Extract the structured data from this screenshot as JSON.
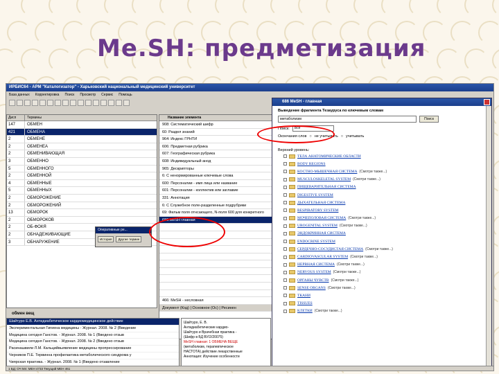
{
  "slide": {
    "title": "Me.SH: предметизация"
  },
  "app": {
    "title": "ИРБИС64 - АРМ \"Каталогизатор\" - Харьковский национальный медицинский университет",
    "menu": [
      "База данных",
      "Корректировка",
      "Поиск",
      "Просмотр",
      "Сервис",
      "Помощь"
    ],
    "left_panel": {
      "headers": [
        "Дисп",
        "Термины"
      ],
      "rows": [
        {
          "n": "147",
          "t": "ОБМЕН"
        },
        {
          "n": "421",
          "t": "ОБМЕНА"
        },
        {
          "n": "2",
          "t": "ОБМЕНЕ"
        },
        {
          "n": "2",
          "t": "ОБМЕНЕА"
        },
        {
          "n": "2",
          "t": "ОБМЕНИВАЮЩАЯ"
        },
        {
          "n": "3",
          "t": "ОБМЕННО"
        },
        {
          "n": "5",
          "t": "ОБМЕННОГО"
        },
        {
          "n": "2",
          "t": "ОБМЕННОЙ"
        },
        {
          "n": "4",
          "t": "ОБМЕННЫЕ"
        },
        {
          "n": "5",
          "t": "ОБМЕННЫХ"
        },
        {
          "n": "2",
          "t": "ОБМОРОЖЕНИЕ"
        },
        {
          "n": "2",
          "t": "ОБМОРОЖЕНИЙ"
        },
        {
          "n": "13",
          "t": "ОБМОРОК"
        },
        {
          "n": "2",
          "t": "ОБМОРОКОВ"
        },
        {
          "n": "2",
          "t": "ОБ-ФОКЯ"
        },
        {
          "n": "2",
          "t": "ОБНАДЕЖИВАЮЩИЕ"
        },
        {
          "n": "3",
          "t": "ОБНАРУЖЕНИЕ"
        }
      ]
    },
    "mid_panel": {
      "header": "Название элемента",
      "rows": [
        "908: Систематический шифр",
        "60: Раздел знаний",
        "964: Индекс ГРНТИ",
        "606: Предметная рубрика",
        "607: Географическая рубрика",
        "608: Индивидуальный анод",
        "965: Дескрипторы",
        "6: С ненормированные ключевые слова",
        "600: Персоналии - имя лица или название",
        "601: Персоналии - коллектив или заглавие",
        "331: Аннотация",
        "6: С Служебное поле-разделенные подрубрики",
        "69: Фильм поля отнсающего, N-поля 600 для конкретного",
        "686:MeSH главная",
        "",
        "",
        "",
        "",
        "",
        "",
        "",
        "",
        "",
        "",
        "466: MeSH - несловная"
      ],
      "selected_index": 13,
      "tabs": "Документ (Код) | Основное (Ос) | Ресинен"
    },
    "popup": {
      "title": "Оперативные ре...",
      "buttons": [
        "История",
        "Другие термин"
      ]
    },
    "bottom": {
      "label": "обмен вещ",
      "rows": [
        "Шайтуро Е.В. Антидиабетическое кардиомедицинское действие",
        "Экспериментальная Гигиена медицины - Журнал. 2008. № 2 (Введение",
        "Медицина сегодня Ганстов. - Журнал. 2008. № 1 (Введено отзыв",
        "Медицина сегодня Ганстов. - Журнал. 2008. № 2 (Введено отзыв",
        "Расинашвили Л.М. Кальцийвыявление медицины пропрессирование",
        "Черников П.Е. Тервинна профилактика метаболического синдрома у",
        "Чиярская практика. - Журнал. 2008. № 1 (Введено отзавление"
      ]
    },
    "detail": {
      "lines": [
        "Шайтуро, Е. В.",
        "Антидиабетические кардио-",
        "Шайтуро и Врачебная практика -",
        "(Шифр в БД ВУ/2/20075)",
        "MeSH главная: 1 ОБМЕНА ВЕЩЕ",
        "(метаболизм, терапевтическое",
        "НАСТОТА) действие лекарственные",
        "Аннотация: Изучение особенности"
      ],
      "highlight": "ОБМЕНА"
    },
    "status": "1 БД: ОЧ Мл: МЕН 4733   Текущий МЕН 461"
  },
  "mesh_window": {
    "title": "686 MeSH - главная",
    "search_caption": "Выведение фрагмента Тезауруса по ключевым словам",
    "search_value": "метаболизм",
    "search_button": "Поиск",
    "field_label": "Поиск:",
    "field_value": "Все",
    "ending_label": "Окончания слов",
    "ending_opt1": "не учитывать",
    "ending_opt2": "учитывать",
    "tree_title": "Верхний уровень:",
    "items": [
      {
        "label": "ТЕЛА АНАТОМИЧЕСКИЕ ОБЛАСТИ",
        "note": ""
      },
      {
        "label": "BODY REGIONS",
        "note": ""
      },
      {
        "label": "КОСТНО-МЫШЕЧНАЯ СИСТЕМА",
        "note": "(Смотри также...)"
      },
      {
        "label": "MUSCULOSKELETAL SYSTEM",
        "note": "(Смотри также...)"
      },
      {
        "label": "ПИЩЕВАРИТЕЛЬНАЯ СИСТЕМА",
        "note": ""
      },
      {
        "label": "DIGESTIVE SYSTEM",
        "note": ""
      },
      {
        "label": "ДЫХАТЕЛЬНАЯ СИСТЕМА",
        "note": ""
      },
      {
        "label": "RESPIRATORY SYSTEM",
        "note": ""
      },
      {
        "label": "МОЧЕПОЛОВАЯ СИСТЕМА",
        "note": "(Смотри также...)"
      },
      {
        "label": "UROGENITAL SYSTEM",
        "note": "(Смотри также...)"
      },
      {
        "label": "ЭНДОКРИННАЯ СИСТЕМА",
        "note": ""
      },
      {
        "label": "ENDOCRINE SYSTEM",
        "note": ""
      },
      {
        "label": "СЕРДЕЧНО-СОСУДИСТАЯ СИСТЕМА",
        "note": "(Смотри также...)"
      },
      {
        "label": "CARDIOVASCULAR SYSTEM",
        "note": "(Смотри также...)"
      },
      {
        "label": "НЕРВНАЯ СИСТЕМА",
        "note": "(Смотри также...)"
      },
      {
        "label": "NERVOUS SYSTEM",
        "note": "(Смотри также...)"
      },
      {
        "label": "ОРГАНЫ ЧУВСТВ",
        "note": "(Смотри также...)"
      },
      {
        "label": "SENSE ORGANS",
        "note": "(Смотри также...)"
      },
      {
        "label": "ТКАНИ",
        "note": ""
      },
      {
        "label": "TISSUES",
        "note": ""
      },
      {
        "label": "КЛЕТКИ",
        "note": "(Смотри также...)"
      }
    ],
    "status_right": "09:22 09.04"
  },
  "colors": {
    "title": "#6b3a8c",
    "highlight_ellipse": "#e00000",
    "selection": "#0a246a"
  }
}
